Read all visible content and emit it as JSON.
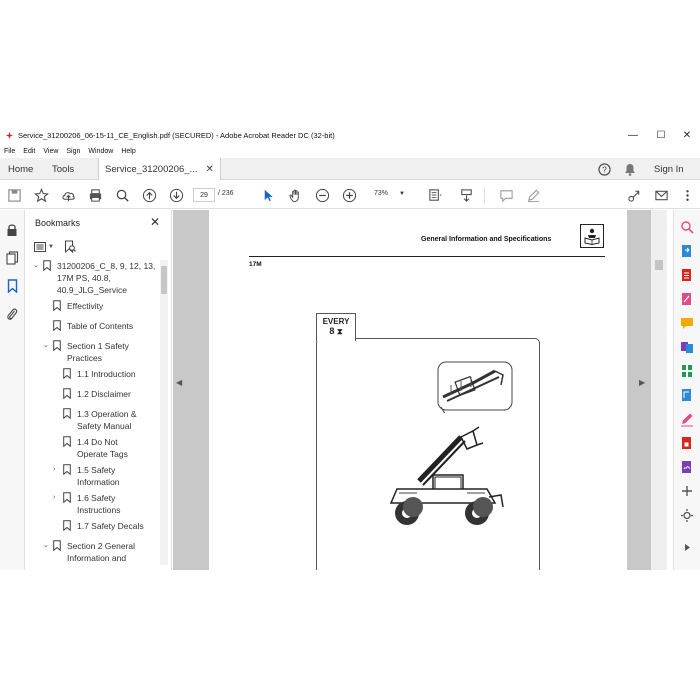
{
  "window": {
    "title": "Service_31200206_06-15-11_CE_English.pdf (SECURED) - Adobe Acrobat Reader DC (32-bit)",
    "controls": {
      "minimize": "—",
      "maximize": "☐",
      "close": "✕"
    }
  },
  "menu": [
    "File",
    "Edit",
    "View",
    "Sign",
    "Window",
    "Help"
  ],
  "tabs": {
    "home": "Home",
    "tools": "Tools",
    "document": "Service_31200206_...",
    "sign_in": "Sign In"
  },
  "toolbar": {
    "current_page": "29",
    "total_pages": "/ 236",
    "zoom": "73%"
  },
  "bookmarks": {
    "title": "Bookmarks",
    "items": [
      {
        "label": "31200206_C_8, 9, 12, 13, 17M PS, 40.8, 40.9_JLG_Service",
        "caret": "⌄"
      },
      {
        "label": "Effectivity",
        "caret": ""
      },
      {
        "label": "Table of Contents",
        "caret": ""
      },
      {
        "label": "Section 1 Safety Practices",
        "caret": "⌄"
      },
      {
        "label": "1.1 Introduction",
        "caret": ""
      },
      {
        "label": "1.2 Disclaimer",
        "caret": ""
      },
      {
        "label": "1.3 Operation & Safety Manual",
        "caret": ""
      },
      {
        "label": "1.4 Do Not Operate Tags",
        "caret": ""
      },
      {
        "label": "1.5 Safety Information",
        "caret": "›"
      },
      {
        "label": "1.6 Safety Instructions",
        "caret": "›"
      },
      {
        "label": "1.7 Safety Decals",
        "caret": ""
      },
      {
        "label": "Section 2 General Information and",
        "caret": "⌄"
      }
    ]
  },
  "page": {
    "header": "General Information and Specifications",
    "model": "17M",
    "interval_label": "EVERY",
    "interval_value": "8"
  },
  "colors": {
    "accent_blue": "#1a63c9",
    "acrobat_red": "#d7261f",
    "tool_icons": [
      "#e34a8a",
      "#2a8ad4",
      "#d7261f",
      "#f2a900",
      "#7a3fb5",
      "#1f9a5a",
      "#2a8ad4",
      "#d7261f",
      "#e34a8a",
      "#7a3fb5",
      "#2a8ad4",
      "#555555",
      "#555555"
    ]
  }
}
